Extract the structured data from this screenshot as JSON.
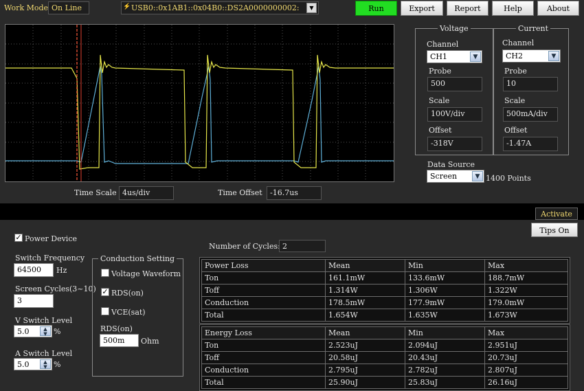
{
  "topbar": {
    "work_mode_label": "Work Mode",
    "work_mode_value": "On Line",
    "device_address": "USB0::0x1AB1::0x04B0::DS2A0000000002:",
    "buttons": {
      "run": "Run",
      "export": "Export",
      "report": "Report",
      "help": "Help",
      "about": "About"
    }
  },
  "scope": {
    "time_scale_label": "Time Scale",
    "time_scale_value": "4us/div",
    "time_offset_label": "Time Offset",
    "time_offset_value": "-16.7us"
  },
  "voltage": {
    "title": "Voltage",
    "channel_label": "Channel",
    "channel": "CH1",
    "probe_label": "Probe",
    "probe": "500",
    "scale_label": "Scale",
    "scale": "100V/div",
    "offset_label": "Offset",
    "offset": "-318V"
  },
  "current": {
    "title": "Current",
    "channel_label": "Channel",
    "channel": "CH2",
    "probe_label": "Probe",
    "probe": "10",
    "scale_label": "Scale",
    "scale": "500mA/div",
    "offset_label": "Offset",
    "offset": "-1.47A"
  },
  "data_source": {
    "label": "Data Source",
    "value": "Screen",
    "points": "1400 Points"
  },
  "activate_label": "Activate",
  "tips_label": "Tips On",
  "settings": {
    "power_device_label": "Power Device",
    "switch_freq_label": "Switch Frequency",
    "switch_freq_value": "64500",
    "switch_freq_unit": "Hz",
    "screen_cycles_label": "Screen Cycles(3~10)",
    "screen_cycles_value": "3",
    "v_switch_label": "V Switch Level",
    "v_switch_value": "5.0",
    "a_switch_label": "A Switch Level",
    "a_switch_value": "5.0",
    "percent": "%",
    "conduction_title": "Conduction Setting",
    "voltage_waveform_label": "Voltage Waveform",
    "rds_on_label": "RDS(on)",
    "vce_sat_label": "VCE(sat)",
    "rds_field_label": "RDS(on)",
    "rds_value": "500m",
    "ohm": "Ohm"
  },
  "cycles": {
    "label": "Number of Cycles:",
    "value": "2"
  },
  "power_loss": {
    "header": [
      "Power Loss",
      "Mean",
      "Min",
      "Max"
    ],
    "rows": [
      [
        "Ton",
        "161.1mW",
        "133.6mW",
        "188.7mW"
      ],
      [
        "Toff",
        "1.314W",
        "1.306W",
        "1.322W"
      ],
      [
        "Conduction",
        "178.5mW",
        "177.9mW",
        "179.0mW"
      ],
      [
        "Total",
        "1.654W",
        "1.635W",
        "1.673W"
      ]
    ]
  },
  "energy_loss": {
    "header": [
      "Energy Loss",
      "Mean",
      "Min",
      "Max"
    ],
    "rows": [
      [
        "Ton",
        "2.523uJ",
        "2.094uJ",
        "2.951uJ"
      ],
      [
        "Toff",
        "20.58uJ",
        "20.43uJ",
        "20.73uJ"
      ],
      [
        "Conduction",
        "2.795uJ",
        "2.782uJ",
        "2.807uJ"
      ],
      [
        "Total",
        "25.90uJ",
        "25.83uJ",
        "26.16uJ"
      ]
    ]
  },
  "colors": {
    "voltage_trace": "#e8e84a",
    "current_trace": "#5fb0d8",
    "cursor": "#ff5a3a",
    "run_button": "#22dd22"
  }
}
